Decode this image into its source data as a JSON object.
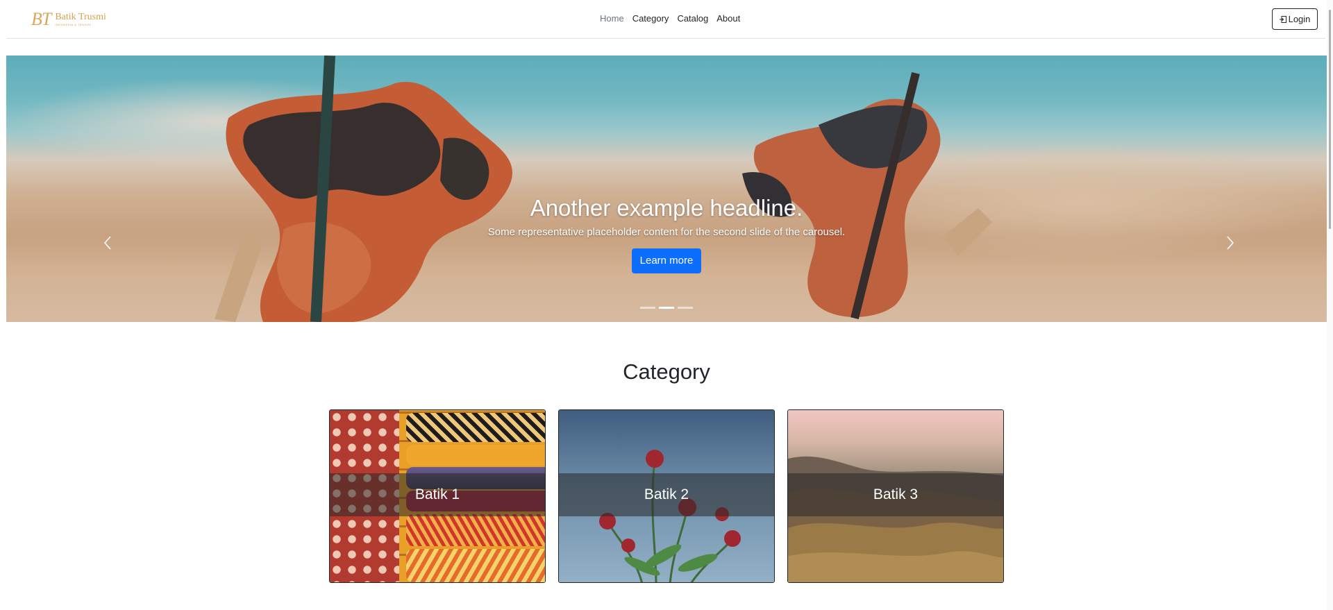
{
  "brand": {
    "mark": "BT",
    "name": "Batik Trusmi",
    "tagline": "INDONESIA & TRADISI"
  },
  "nav": {
    "links": [
      "Home",
      "Category",
      "Catalog",
      "About"
    ],
    "active": "Home",
    "login_label": "Login"
  },
  "carousel": {
    "title": "Another example headline.",
    "text": "Some representative placeholder content for the second slide of the carousel.",
    "button_label": "Learn more",
    "slide_count": 3,
    "active_slide": 2
  },
  "category": {
    "title": "Category",
    "cards": [
      {
        "label": "Batik 1",
        "image": "batik-pillows"
      },
      {
        "label": "Batik 2",
        "image": "red-flowers-sky"
      },
      {
        "label": "Batik 3",
        "image": "mountain-hills"
      }
    ]
  },
  "colors": {
    "primary": "#0d6efd",
    "brand_gold": "#d4a050",
    "text": "#212529"
  }
}
